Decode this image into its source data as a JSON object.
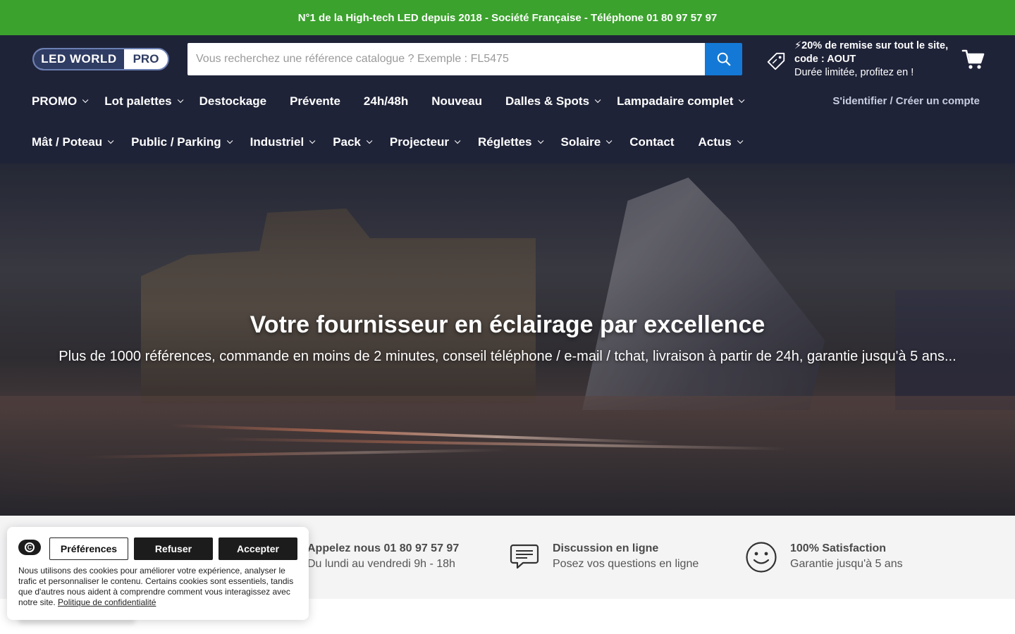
{
  "announcement": "N°1 de la High-tech LED depuis 2018 - Société Française - Téléphone 01 80 97 57 97",
  "logo": {
    "left": "LED WORLD",
    "right": "PRO"
  },
  "search": {
    "placeholder": "Vous recherchez une référence catalogue ? Exemple : FL5475",
    "button_icon": "search-icon"
  },
  "promo": {
    "icon": "tag-icon",
    "line1": "⚡20% de remise sur tout le site, code : AOUT",
    "line2": "Durée limitée, profitez en !"
  },
  "cart_icon": "cart-icon",
  "nav": {
    "row1": [
      {
        "label": "PROMO",
        "dropdown": true
      },
      {
        "label": "Lot palettes",
        "dropdown": true
      },
      {
        "label": "Destockage",
        "dropdown": false
      },
      {
        "label": "Prévente",
        "dropdown": false
      },
      {
        "label": "24h/48h",
        "dropdown": false
      },
      {
        "label": "Nouveau",
        "dropdown": false
      },
      {
        "label": "Dalles & Spots",
        "dropdown": true
      },
      {
        "label": "Lampadaire complet",
        "dropdown": true
      }
    ],
    "row2": [
      {
        "label": "Mât / Poteau",
        "dropdown": true
      },
      {
        "label": "Public / Parking",
        "dropdown": true
      },
      {
        "label": "Industriel",
        "dropdown": true
      },
      {
        "label": "Pack",
        "dropdown": true
      },
      {
        "label": "Projecteur",
        "dropdown": true
      },
      {
        "label": "Réglettes",
        "dropdown": true
      },
      {
        "label": "Solaire",
        "dropdown": true
      },
      {
        "label": "Contact",
        "dropdown": false
      },
      {
        "label": "Actus",
        "dropdown": true
      }
    ],
    "login": "S'identifier / Créer un compte"
  },
  "hero": {
    "title": "Votre fournisseur en éclairage par excellence",
    "subtitle": "Plus de 1000 références, commande en moins de 2 minutes, conseil téléphone / e-mail / tchat, livraison à partir de 24h, garantie jusqu'à 5 ans..."
  },
  "features": [
    {
      "icon": "phone-icon",
      "title": "Appelez nous 01 80 97 57 97",
      "subtitle": "Du lundi au vendredi 9h - 18h"
    },
    {
      "icon": "chat-icon",
      "title": "Discussion en ligne",
      "subtitle": "Posez vos questions en ligne"
    },
    {
      "icon": "smiley-icon",
      "title": "100% Satisfaction",
      "subtitle": "Garantie jusqu'à 5 ans"
    }
  ],
  "cookie": {
    "logo_icon": "cookie-consent-icon",
    "preferences": "Préférences",
    "refuse": "Refuser",
    "accept": "Accepter",
    "text": "Nous utilisons des cookies pour améliorer votre expérience, analyser le trafic et personnaliser le contenu. Certains cookies sont essentiels, tandis que d'autres nous aident à comprendre comment vous interagissez avec notre site. ",
    "policy_link": "Politique de confidentialité"
  },
  "colors": {
    "announcement_bg": "#3ba22d",
    "header_bg": "#1f2338",
    "search_button": "#1479d6",
    "features_bg": "#f4f4f5"
  }
}
